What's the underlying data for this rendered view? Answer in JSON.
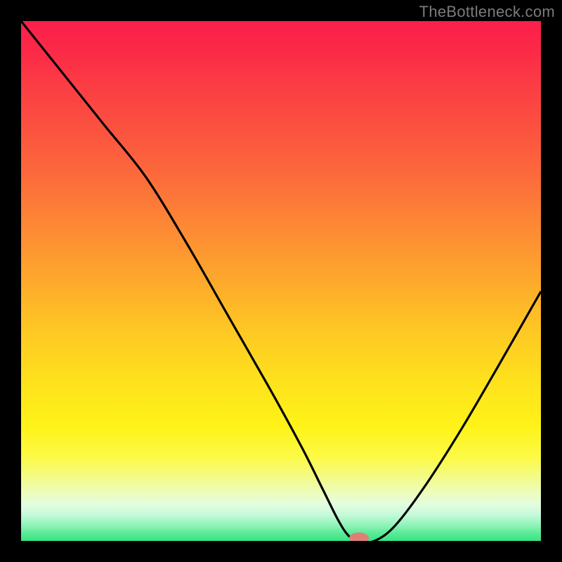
{
  "watermark": "TheBottleneck.com",
  "chart_data": {
    "type": "line",
    "title": "",
    "xlabel": "",
    "ylabel": "",
    "xlim": [
      0,
      100
    ],
    "ylim": [
      0,
      100
    ],
    "x": [
      0,
      8,
      16,
      24,
      32,
      40,
      48,
      54,
      58,
      61,
      63,
      65,
      68,
      72,
      78,
      85,
      92,
      100
    ],
    "values": [
      100,
      90,
      80,
      70,
      57,
      43,
      29,
      18,
      10,
      4,
      1,
      0,
      0,
      3,
      11,
      22,
      34,
      48
    ],
    "marker": {
      "x": 65,
      "y": 0
    },
    "gradient": {
      "top_color": "#fb1f4a",
      "bottom_color": "#36e582"
    }
  }
}
